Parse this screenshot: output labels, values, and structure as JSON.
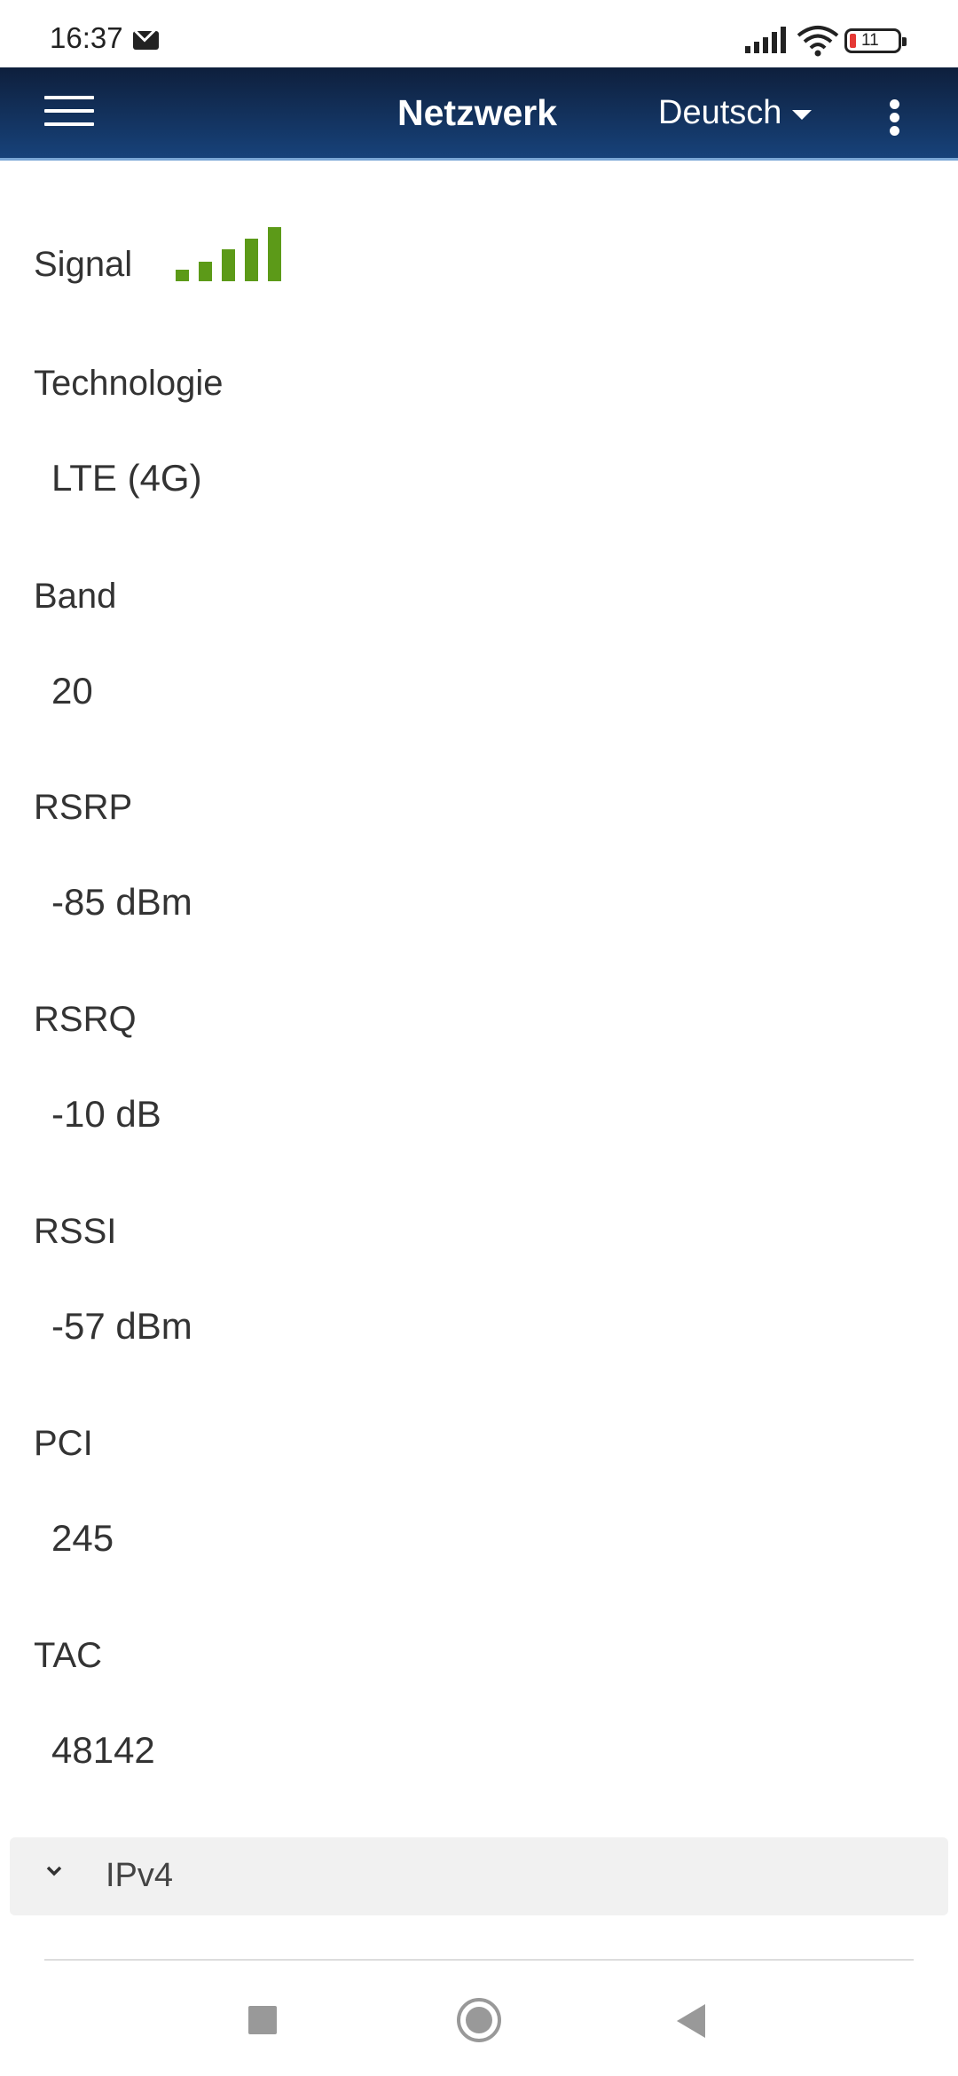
{
  "status_bar": {
    "time": "16:37",
    "battery_level": "11",
    "icons": [
      "mail-icon",
      "signal-icon",
      "wifi-icon",
      "battery-icon"
    ]
  },
  "app_bar": {
    "title": "Netzwerk",
    "language": "Deutsch",
    "icons": [
      "menu-icon",
      "caret-down-icon",
      "more-vert-icon"
    ],
    "color_top": "#0e1f3c",
    "color_bottom": "#17427a"
  },
  "network": {
    "signal_label": "Signal",
    "signal_bars_total": 5,
    "signal_bars_active": 5,
    "signal_color": "#5c9a18",
    "fields": [
      {
        "label": "Technologie",
        "value": "LTE (4G)"
      },
      {
        "label": "Band",
        "value": "20"
      },
      {
        "label": "RSRP",
        "value": "-85 dBm"
      },
      {
        "label": "RSRQ",
        "value": "-10 dB"
      },
      {
        "label": "RSSI",
        "value": "-57 dBm"
      },
      {
        "label": "PCI",
        "value": "245"
      },
      {
        "label": "TAC",
        "value": "48142"
      }
    ]
  },
  "ipv4_section": {
    "label": "IPv4",
    "icon": "chevron-down-icon"
  },
  "nav_bar": {
    "icons": [
      "recents-icon",
      "home-icon",
      "back-icon"
    ]
  }
}
